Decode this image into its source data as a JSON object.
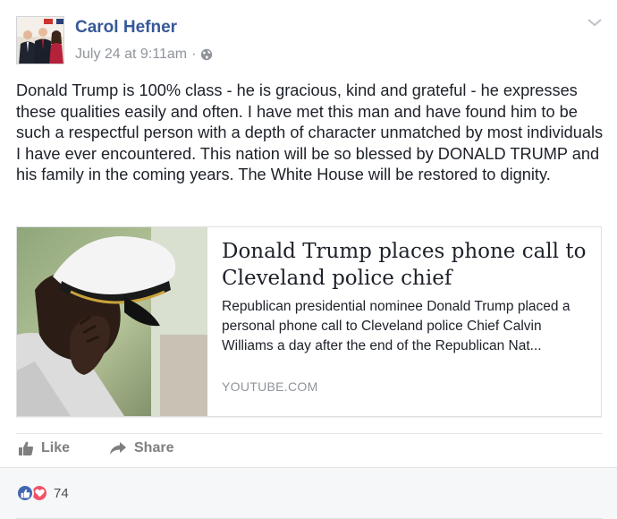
{
  "post": {
    "author_name": "Carol Hefner",
    "timestamp": "July 24 at 9:11am",
    "separator": "·",
    "audience_icon": "globe-icon",
    "menu_icon": "chevron-down-icon",
    "text": "Donald Trump is 100% class - he is gracious, kind and grateful - he expresses these qualities easily and often. I have met this man and have found him to be such a respectful person with a depth of character unmatched by most individuals I have ever encountered. This nation will be so blessed by DONALD TRUMP and his family in the coming years. The White House will be restored to dignity."
  },
  "link_card": {
    "title": "Donald Trump places phone call to Cleveland police chief",
    "description": "Republican presidential nominee Donald Trump placed a personal phone call to Cleveland police Chief Calvin Williams a day after the end of the Republican Nat...",
    "domain": "YOUTUBE.COM"
  },
  "actions": {
    "like_label": "Like",
    "share_label": "Share"
  },
  "reactions": {
    "count": "74",
    "icons": [
      "like-reaction-icon",
      "love-reaction-icon"
    ]
  },
  "colors": {
    "author_link": "#365899",
    "meta_gray": "#90949c",
    "like_blue": "#4267b2",
    "love_red": "#f25268"
  }
}
